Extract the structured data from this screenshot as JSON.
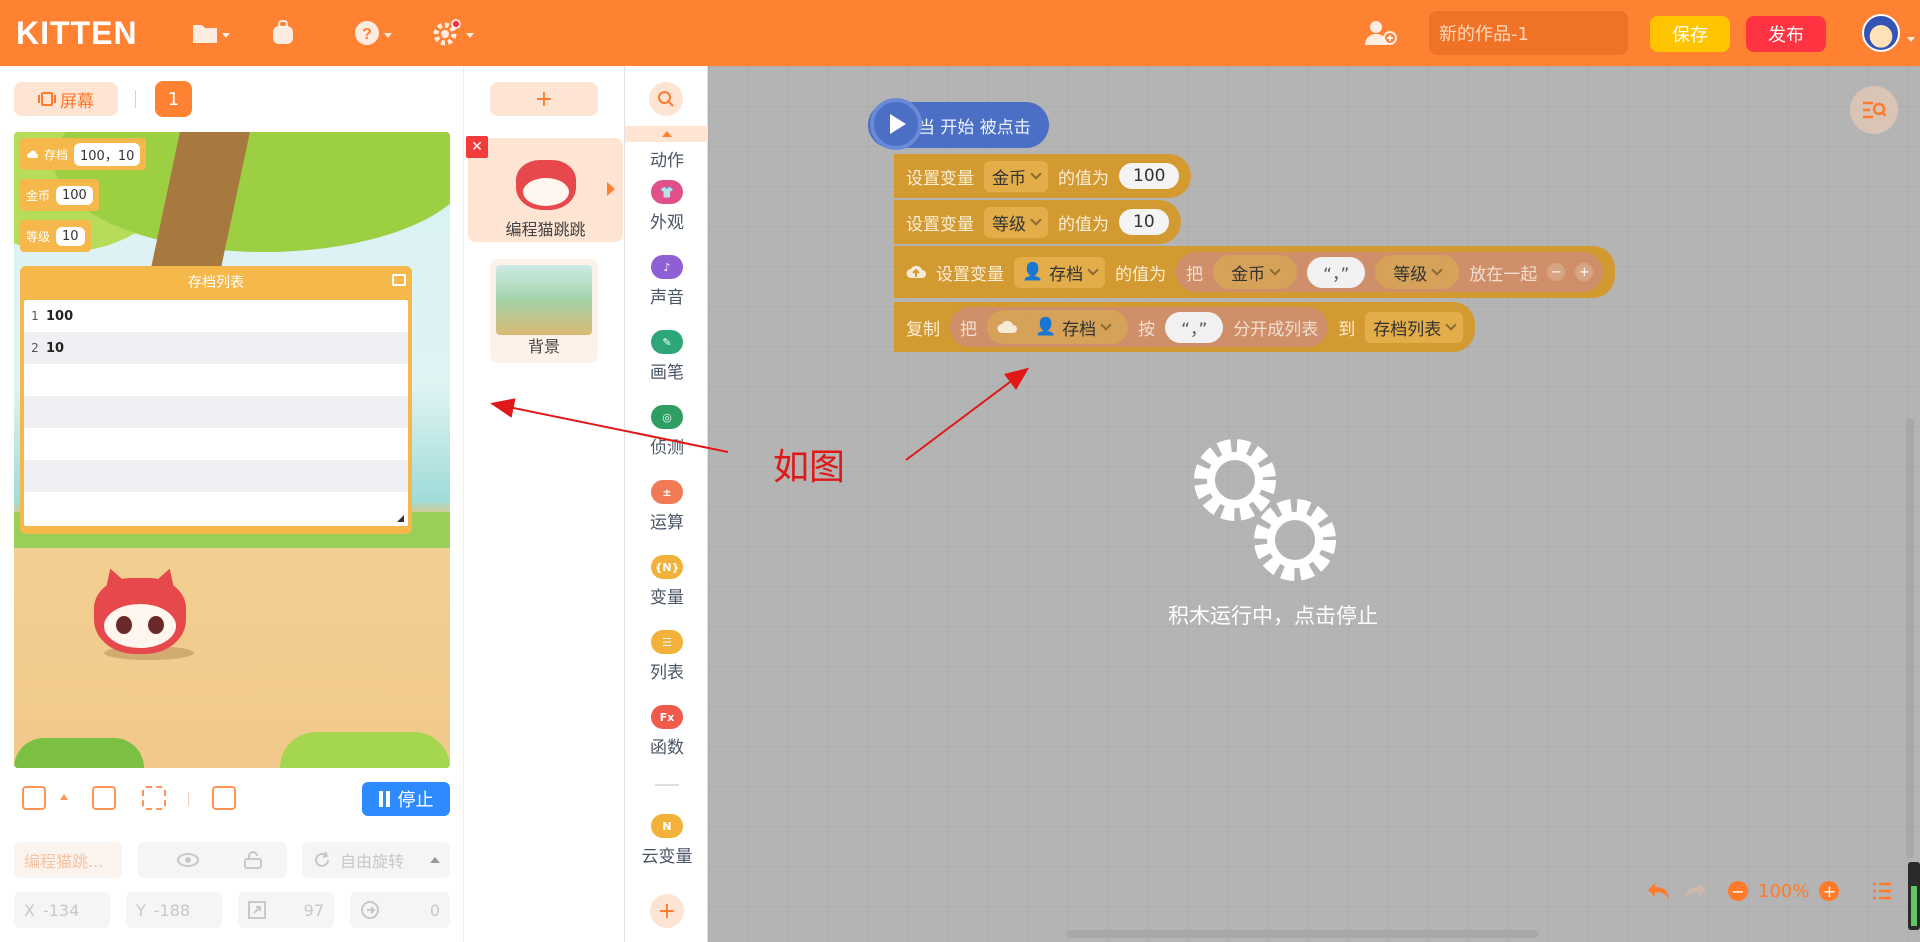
{
  "app": {
    "logo": "KITTEN",
    "project_title": "新的作品-1",
    "save_label": "保存",
    "publish_label": "发布",
    "accent": "#ff8132"
  },
  "stage_panel": {
    "screen_tab": "屏幕",
    "scene_number": "1",
    "stop_label": "停止",
    "vars": [
      {
        "name": "存档",
        "value": "100，10"
      },
      {
        "name": "金币",
        "value": "100"
      },
      {
        "name": "等级",
        "value": "10"
      }
    ],
    "list": {
      "title": "存档列表",
      "rows": [
        {
          "index": "1",
          "value": "100"
        },
        {
          "index": "2",
          "value": "10"
        }
      ]
    },
    "properties": {
      "sprite_name": "编程猫跳...",
      "rotation_mode": "自由旋转",
      "x_label": "X",
      "x_value": "-134",
      "y_label": "Y",
      "y_value": "-188",
      "size_value": "97",
      "direction_value": "0"
    }
  },
  "sprites": {
    "add_label": "+",
    "items": [
      {
        "name": "编程猫跳跳"
      },
      {
        "name": "背景"
      }
    ]
  },
  "categories": {
    "items": [
      {
        "label": "动作",
        "color": "#f08a55"
      },
      {
        "label": "外观",
        "color": "#e2508a"
      },
      {
        "label": "声音",
        "color": "#8f5fd6"
      },
      {
        "label": "画笔",
        "color": "#2da67a"
      },
      {
        "label": "侦测",
        "color": "#2f9e63"
      },
      {
        "label": "运算",
        "color": "#f07a55"
      },
      {
        "label": "变量",
        "color": "#f2b138"
      },
      {
        "label": "列表",
        "color": "#f2b138"
      },
      {
        "label": "函数",
        "color": "#ef5a4a"
      },
      {
        "label": "云变量",
        "color": "#f2b138"
      }
    ]
  },
  "workspace": {
    "start_block": "当 开始 被点击",
    "set_var_label": "设置变量",
    "value_of": "的值为",
    "block1": {
      "var": "金币",
      "value": "100"
    },
    "block2": {
      "var": "等级",
      "value": "10"
    },
    "block3": {
      "var": "存档",
      "join_word": "把",
      "part1": "金币",
      "sep": "“，”",
      "part2": "等级",
      "put_together": "放在一起"
    },
    "block4": {
      "copy_label": "复制",
      "join_word": "把",
      "var": "存档",
      "by_label": "按",
      "sep": "“，”",
      "split_label": "分开成列表",
      "to_label": "到",
      "target": "存档列表"
    },
    "annotation": "如图",
    "running_text": "积木运行中，点击停止",
    "zoom": "100%"
  }
}
